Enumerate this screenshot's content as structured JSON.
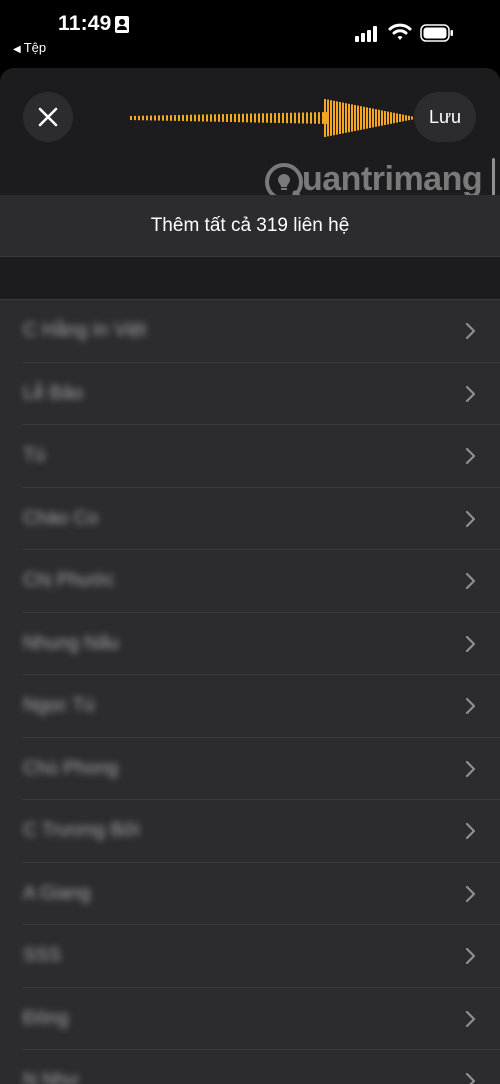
{
  "status_bar": {
    "time": "11:49",
    "back_app": "Tệp",
    "back_icon": "back-triangle-icon",
    "icons": [
      "contact-card-icon",
      "cellular-signal-icon",
      "wifi-icon",
      "battery-icon"
    ]
  },
  "nav": {
    "close_icon": "close-icon",
    "save_label": "Lưu"
  },
  "watermark": {
    "text": "uantrimang",
    "icon": "lightbulb-logo-icon"
  },
  "add_all_label": "Thêm tất cả 319 liên hệ",
  "contacts": [
    {
      "name": "C Hằng In Việt"
    },
    {
      "name": "Lễ Bảo"
    },
    {
      "name": "Tú"
    },
    {
      "name": "Chào Co"
    },
    {
      "name": "Chị Phước"
    },
    {
      "name": "Nhung Nấu"
    },
    {
      "name": "Ngọc Tú"
    },
    {
      "name": "Chú Phong"
    },
    {
      "name": "C Trương Bởi"
    },
    {
      "name": "A Giang"
    },
    {
      "name": "SSS"
    },
    {
      "name": "Đông"
    },
    {
      "name": "N Như"
    }
  ],
  "colors": {
    "sheet_bg": "#1c1c1e",
    "row_bg": "#2c2c2e",
    "annotation_arrow": "#f5a623"
  }
}
